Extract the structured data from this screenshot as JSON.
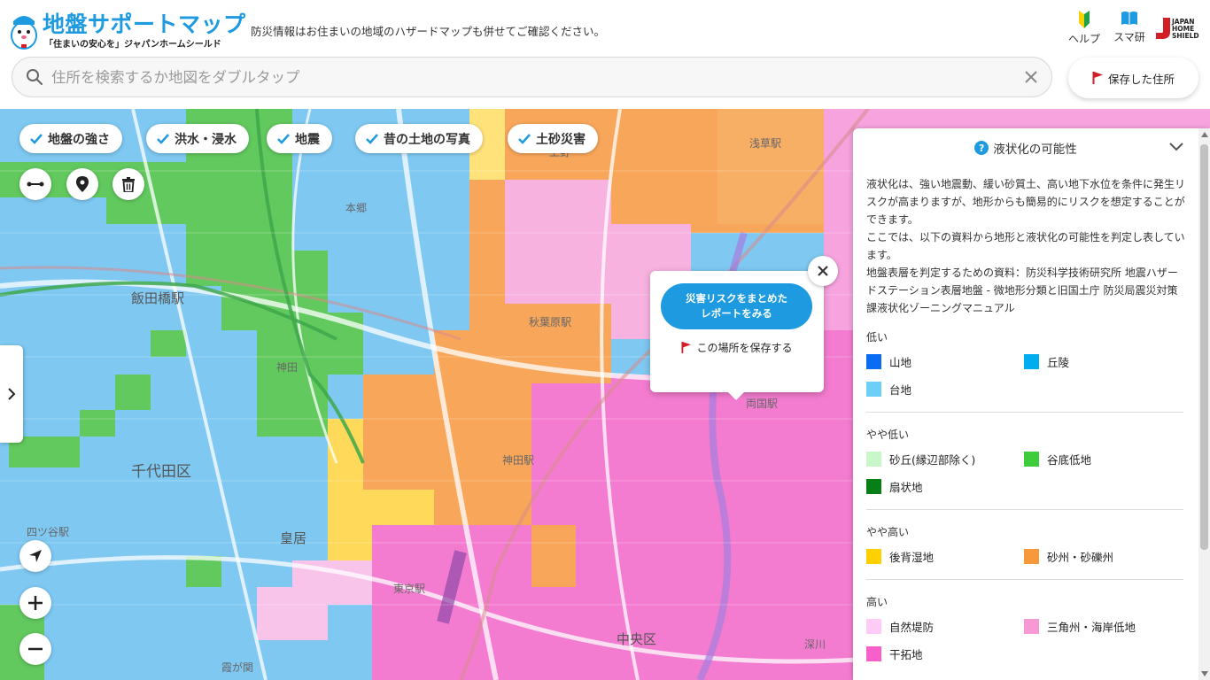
{
  "header": {
    "app_title": "地盤サポートマップ",
    "tagline": "「住まいの安心を」ジャパンホームシールド",
    "notice": "防災情報はお住まいの地域のハザードマップも併せてご確認ください。",
    "help_label": "ヘルプ",
    "sumaken_label": "スマ研",
    "brand_logo_text": "JAPAN HOME SHIELD"
  },
  "search": {
    "placeholder": "住所を検索するか地図をダブルタップ",
    "value": ""
  },
  "saved_button": {
    "label": "保存した住所"
  },
  "layer_chips": [
    {
      "label": "地盤の強さ",
      "checked": true
    },
    {
      "label": "洪水・浸水",
      "checked": true
    },
    {
      "label": "地震",
      "checked": true
    },
    {
      "label": "昔の土地の写真",
      "checked": true
    },
    {
      "label": "土砂災害",
      "checked": true
    }
  ],
  "tools": [
    "measure-icon",
    "pin-icon",
    "trash-icon"
  ],
  "map_controls": [
    "locate-icon",
    "zoom-in-icon",
    "zoom-out-icon"
  ],
  "popup": {
    "report_line1": "災害リスクをまとめた",
    "report_line2": "レポートをみる",
    "save_label": "この場所を保存する"
  },
  "map_labels": {
    "iidabashi": "飯田橋駅",
    "kanda": "神田",
    "chiyoda": "千代田区",
    "kokyo": "皇居",
    "tokyo_st": "東京駅",
    "akihabara": "秋葉原駅",
    "kanda_st": "神田駅",
    "yotsuya": "四ツ谷駅",
    "chuo": "中央区",
    "kasumigaseki": "霞が関",
    "fukagawa": "深川",
    "hongo": "本郷",
    "asakusa": "浅草駅",
    "ryogoku": "両国駅",
    "ueno": "上野"
  },
  "legend": {
    "title": "液状化の可能性",
    "description": [
      "液状化は、強い地震動、緩い砂質土、高い地下水位を条件に発生リスクが高まりますが、地形からも簡易的にリスクを想定することができます。",
      "ここでは、以下の資料から地形と液状化の可能性を判定し表しています。",
      "地盤表層を判定するための資料：防災科学技術研究所 地震ハザードステーション表層地盤 - 微地形分類と旧国土庁 防災局震災対策課液状化ゾーニングマニュアル"
    ],
    "categories": [
      {
        "label": "低い",
        "items": [
          {
            "label": "山地",
            "color": "#0a6cf2"
          },
          {
            "label": "丘陵",
            "color": "#00aeef"
          },
          {
            "label": "台地",
            "color": "#6ccff6"
          }
        ]
      },
      {
        "label": "やや低い",
        "items": [
          {
            "label": "砂丘(縁辺部除く)",
            "color": "#c9f7c9"
          },
          {
            "label": "谷底低地",
            "color": "#3ccc3c"
          },
          {
            "label": "扇状地",
            "color": "#087f16"
          }
        ]
      },
      {
        "label": "やや高い",
        "items": [
          {
            "label": "後背湿地",
            "color": "#ffd000"
          },
          {
            "label": "砂州・砂礫州",
            "color": "#f7993a"
          }
        ]
      },
      {
        "label": "高い",
        "items": [
          {
            "label": "自然堤防",
            "color": "#ffccf7"
          },
          {
            "label": "三角州・海岸低地",
            "color": "#f79ad3"
          },
          {
            "label": "干拓地",
            "color": "#f760c8"
          }
        ]
      }
    ]
  },
  "colors": {
    "brand": "#1e9be0",
    "flag": "#d11f25"
  }
}
